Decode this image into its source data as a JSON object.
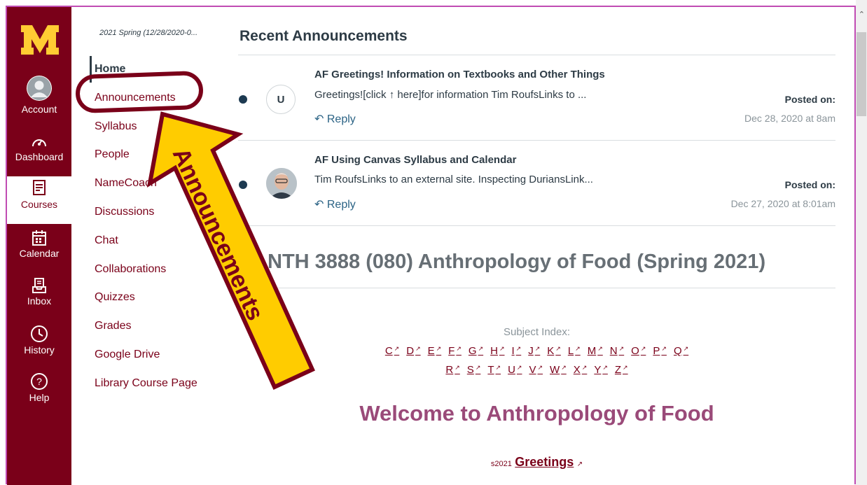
{
  "global_nav": {
    "items": [
      {
        "label": "Account",
        "icon": "account-avatar-icon"
      },
      {
        "label": "Dashboard",
        "icon": "dashboard-icon"
      },
      {
        "label": "Courses",
        "icon": "courses-icon"
      },
      {
        "label": "Calendar",
        "icon": "calendar-icon"
      },
      {
        "label": "Inbox",
        "icon": "inbox-icon"
      },
      {
        "label": "History",
        "icon": "history-icon"
      },
      {
        "label": "Help",
        "icon": "help-icon"
      }
    ],
    "active": "Courses",
    "colors": {
      "brand": "#7a0019",
      "gold": "#ffcc33"
    }
  },
  "course_nav": {
    "term": "2021 Spring (12/28/2020-0...",
    "links": [
      "Home",
      "Announcements",
      "Syllabus",
      "People",
      "NameCoach",
      "Discussions",
      "Chat",
      "Collaborations",
      "Quizzes",
      "Grades",
      "Google Drive",
      "Library Course Page"
    ]
  },
  "announcements": {
    "heading": "Recent Announcements",
    "posted_label": "Posted on:",
    "reply_label": "Reply",
    "items": [
      {
        "avatar": "U",
        "title": "AF Greetings! Information on Textbooks and Other Things",
        "snippet": "Greetings![click ↑ here]for information Tim RoufsLinks to ...",
        "date": "Dec 28, 2020 at 8am"
      },
      {
        "avatar": "",
        "title": "AF Using Canvas Syllabus and Calendar",
        "snippet": "Tim RoufsLinks to an external site. Inspecting DuriansLink...",
        "date": "Dec 27, 2020 at 8:01am"
      }
    ]
  },
  "content": {
    "course_title": "NTH 3888 (080) Anthropology of Food (Spring 2021)",
    "subject_index_label": "Subject Index:",
    "letters_row1": [
      "C",
      "D",
      "E",
      "F",
      "G",
      "H",
      "I",
      "J",
      "K",
      "L",
      "M",
      "N",
      "O",
      "P",
      "Q"
    ],
    "letters_row2": [
      "R",
      "S",
      "T",
      "U",
      "V",
      "W",
      "X",
      "Y",
      "Z"
    ],
    "welcome": "Welcome to Anthropology of Food",
    "greetings_prefix": "s2021",
    "greetings_link": "Greetings"
  },
  "overlay": {
    "arrow_text": "Announcements",
    "arrow_color": "#ffcc00",
    "arrow_border_color": "#7a0019"
  }
}
